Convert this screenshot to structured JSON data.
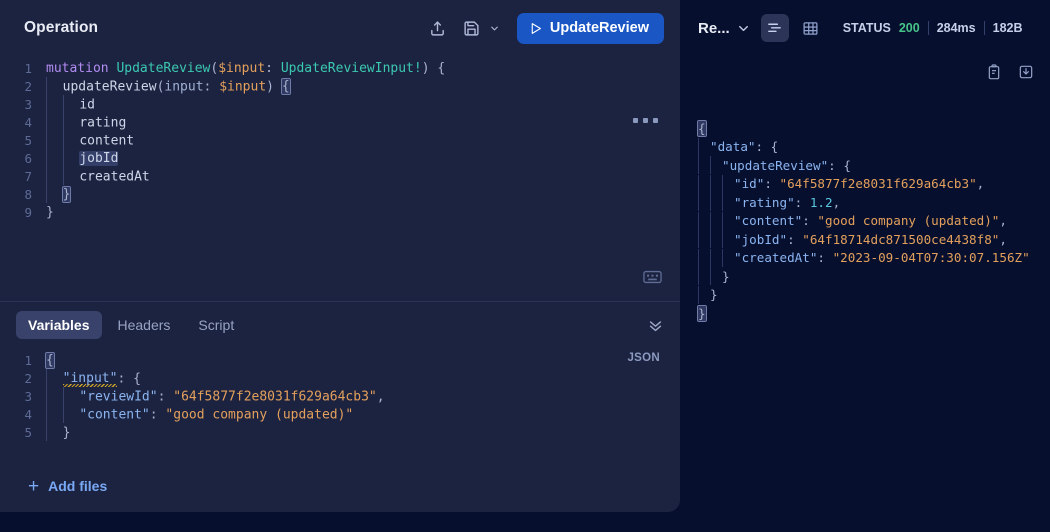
{
  "operation_panel": {
    "title": "Operation",
    "toolbar": {
      "share_icon": "share-upload-icon",
      "save_icon": "save-floppy-icon",
      "save_dropdown_icon": "chevron-down-icon",
      "run_label": "UpdateReview",
      "run_icon": "play-triangle-icon",
      "more_icon": "three-dots-icon",
      "keyboard_icon": "keyboard-icon"
    },
    "code_lines": [
      {
        "n": "1",
        "tokens": [
          {
            "t": "mutation",
            "c": "t-kw"
          },
          {
            "t": " ",
            "c": "t-punc"
          },
          {
            "t": "UpdateReview",
            "c": "t-name"
          },
          {
            "t": "(",
            "c": "t-punc"
          },
          {
            "t": "$input",
            "c": "t-var"
          },
          {
            "t": ": ",
            "c": "t-punc"
          },
          {
            "t": "UpdateReviewInput!",
            "c": "t-type"
          },
          {
            "t": ") {",
            "c": "t-punc"
          }
        ]
      },
      {
        "n": "2",
        "indent": 1,
        "tokens": [
          {
            "t": "updateReview",
            "c": "t-field"
          },
          {
            "t": "(",
            "c": "t-punc"
          },
          {
            "t": "input",
            "c": "t-arg"
          },
          {
            "t": ": ",
            "c": "t-punc"
          },
          {
            "t": "$input",
            "c": "t-var"
          },
          {
            "t": ") ",
            "c": "t-punc"
          },
          {
            "t": "{",
            "c": "t-punc brace-hl"
          }
        ]
      },
      {
        "n": "3",
        "indent": 2,
        "tokens": [
          {
            "t": "id",
            "c": "t-field"
          }
        ]
      },
      {
        "n": "4",
        "indent": 2,
        "tokens": [
          {
            "t": "rating",
            "c": "t-field"
          }
        ]
      },
      {
        "n": "5",
        "indent": 2,
        "tokens": [
          {
            "t": "content",
            "c": "t-field"
          }
        ]
      },
      {
        "n": "6",
        "indent": 2,
        "tokens": [
          {
            "t": "jobId",
            "c": "t-field tok-hl"
          }
        ]
      },
      {
        "n": "7",
        "indent": 2,
        "tokens": [
          {
            "t": "createdAt",
            "c": "t-field"
          }
        ]
      },
      {
        "n": "8",
        "indent": 1,
        "tokens": [
          {
            "t": "}",
            "c": "t-punc brace-hl"
          }
        ]
      },
      {
        "n": "9",
        "indent": 0,
        "tokens": [
          {
            "t": "}",
            "c": "t-punc"
          }
        ]
      }
    ],
    "tabs": [
      {
        "label": "Variables",
        "active": true
      },
      {
        "label": "Headers",
        "active": false
      },
      {
        "label": "Script",
        "active": false
      }
    ],
    "collapse_icon": "chevrons-down-icon",
    "variables_format_label": "JSON",
    "variables_lines": [
      {
        "n": "1",
        "indent": 0,
        "tokens": [
          {
            "t": "{",
            "c": "t-punc brace-hl"
          }
        ]
      },
      {
        "n": "2",
        "indent": 1,
        "tokens": [
          {
            "t": "\"input\"",
            "c": "t-key squiggle"
          },
          {
            "t": ": {",
            "c": "t-punc"
          }
        ]
      },
      {
        "n": "3",
        "indent": 2,
        "tokens": [
          {
            "t": "\"reviewId\"",
            "c": "t-key"
          },
          {
            "t": ": ",
            "c": "t-punc"
          },
          {
            "t": "\"64f5877f2e8031f629a64cb3\"",
            "c": "t-str"
          },
          {
            "t": ",",
            "c": "t-punc"
          }
        ]
      },
      {
        "n": "4",
        "indent": 2,
        "tokens": [
          {
            "t": "\"content\"",
            "c": "t-key"
          },
          {
            "t": ": ",
            "c": "t-punc"
          },
          {
            "t": "\"good company (updated)\"",
            "c": "t-str"
          }
        ]
      },
      {
        "n": "5",
        "indent": 1,
        "tokens": [
          {
            "t": "}",
            "c": "t-punc"
          }
        ]
      }
    ],
    "add_files_label": "Add files",
    "add_files_icon": "plus-icon"
  },
  "response_panel": {
    "title": "Re...",
    "title_chevron_icon": "chevron-down-icon",
    "view_modes": [
      {
        "name": "json-view",
        "icon": "lines-json-icon",
        "active": true
      },
      {
        "name": "table-view",
        "icon": "table-grid-icon",
        "active": false
      }
    ],
    "status_label": "STATUS",
    "status_code": "200",
    "time": "284ms",
    "size": "182B",
    "copy_icon": "clipboard-copy-icon",
    "download_icon": "download-icon",
    "body_lines": [
      {
        "indent": 0,
        "tokens": [
          {
            "t": "{",
            "c": "t-punc brace-hl"
          }
        ]
      },
      {
        "indent": 1,
        "tokens": [
          {
            "t": "\"data\"",
            "c": "t-key"
          },
          {
            "t": ": {",
            "c": "t-punc"
          }
        ]
      },
      {
        "indent": 2,
        "tokens": [
          {
            "t": "\"updateReview\"",
            "c": "t-key"
          },
          {
            "t": ": {",
            "c": "t-punc"
          }
        ]
      },
      {
        "indent": 3,
        "tokens": [
          {
            "t": "\"id\"",
            "c": "t-key"
          },
          {
            "t": ": ",
            "c": "t-punc"
          },
          {
            "t": "\"64f5877f2e8031f629a64cb3\"",
            "c": "t-str"
          },
          {
            "t": ",",
            "c": "t-punc"
          }
        ]
      },
      {
        "indent": 3,
        "tokens": [
          {
            "t": "\"rating\"",
            "c": "t-key"
          },
          {
            "t": ": ",
            "c": "t-punc"
          },
          {
            "t": "1.2",
            "c": "t-num"
          },
          {
            "t": ",",
            "c": "t-punc"
          }
        ]
      },
      {
        "indent": 3,
        "tokens": [
          {
            "t": "\"content\"",
            "c": "t-key"
          },
          {
            "t": ": ",
            "c": "t-punc"
          },
          {
            "t": "\"good company (updated)\"",
            "c": "t-str"
          },
          {
            "t": ",",
            "c": "t-punc"
          }
        ]
      },
      {
        "indent": 3,
        "tokens": [
          {
            "t": "\"jobId\"",
            "c": "t-key"
          },
          {
            "t": ": ",
            "c": "t-punc"
          },
          {
            "t": "\"64f18714dc871500ce4438f8\"",
            "c": "t-str"
          },
          {
            "t": ",",
            "c": "t-punc"
          }
        ]
      },
      {
        "indent": 3,
        "tokens": [
          {
            "t": "\"createdAt\"",
            "c": "t-key"
          },
          {
            "t": ": ",
            "c": "t-punc"
          },
          {
            "t": "\"2023-09-04T07:30:07.156Z\"",
            "c": "t-str"
          }
        ]
      },
      {
        "indent": 2,
        "tokens": [
          {
            "t": "}",
            "c": "t-punc"
          }
        ]
      },
      {
        "indent": 1,
        "tokens": [
          {
            "t": "}",
            "c": "t-punc"
          }
        ]
      },
      {
        "indent": 0,
        "tokens": [
          {
            "t": "}",
            "c": "t-punc brace-hl"
          }
        ]
      }
    ]
  },
  "colors": {
    "panel_bg": "#1c2340",
    "response_bg": "#060f2e",
    "accent_blue": "#1a56c4",
    "link_blue": "#79a9f5",
    "status_green": "#46c48a"
  }
}
